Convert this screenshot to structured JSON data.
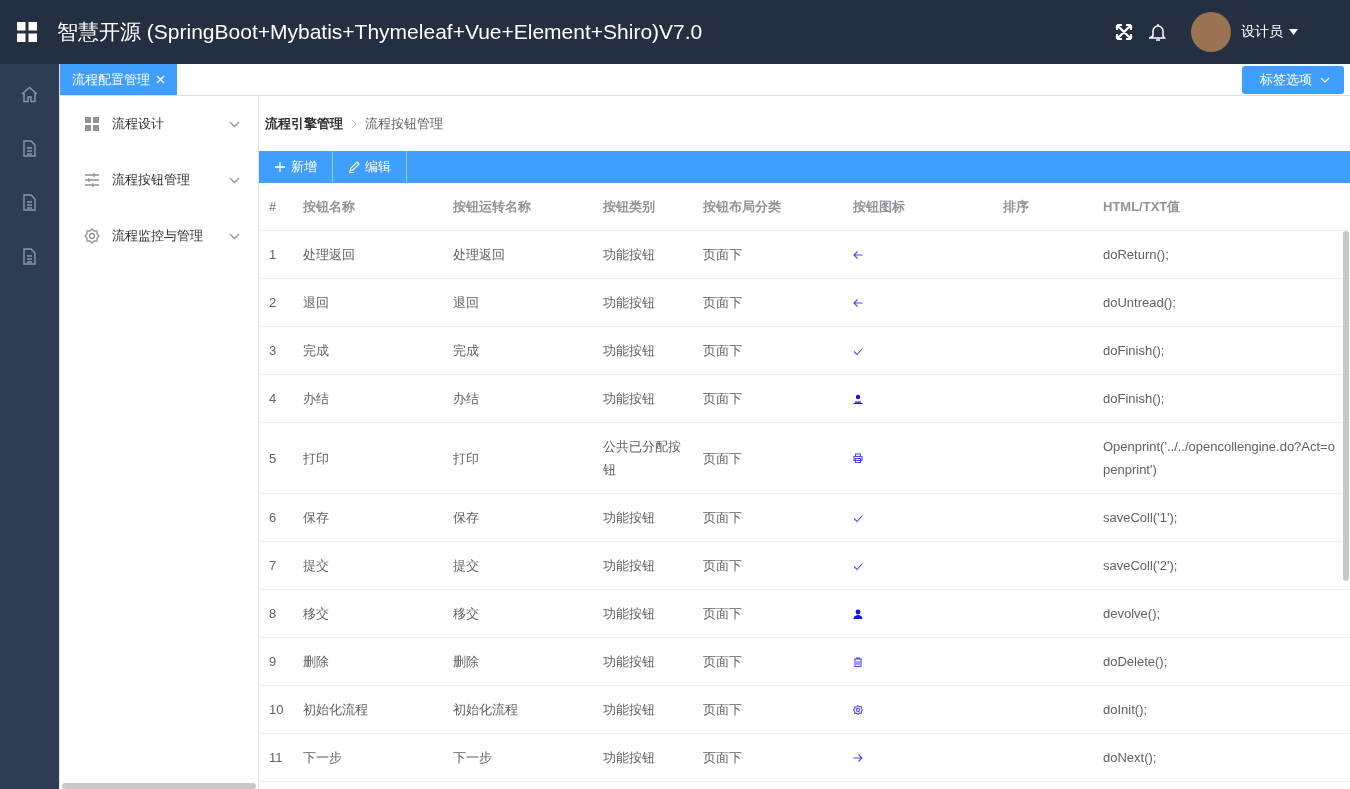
{
  "header": {
    "title": "智慧开源 (SpringBoot+Mybatis+Thymeleaf+Vue+Element+Shiro)V7.0",
    "user": "设计员"
  },
  "tabs": [
    {
      "label": "流程配置管理",
      "selected": true
    }
  ],
  "tab_options": "标签选项",
  "menu": [
    {
      "label": "流程设计",
      "kind": "grid",
      "expanded": false
    },
    {
      "label": "流程按钮管理",
      "kind": "sliders",
      "expanded": false
    },
    {
      "label": "流程监控与管理",
      "kind": "gear",
      "expanded": false
    }
  ],
  "breadcrumb": [
    "流程引擎管理",
    "流程按钮管理"
  ],
  "toolbar": [
    {
      "label": "新增",
      "kind": "add"
    },
    {
      "label": "编辑",
      "kind": "edit"
    }
  ],
  "table": {
    "columns": [
      "#",
      "按钮名称",
      "按钮运转名称",
      "按钮类别",
      "按钮布局分类",
      "按钮图标",
      "排序",
      "HTML/TXT值"
    ],
    "rows": [
      {
        "no": "1",
        "name": "处理返回",
        "run_name": "处理返回",
        "category": "功能按钮",
        "layout": "页面下",
        "kind": "arrow-left",
        "value": "doReturn();"
      },
      {
        "no": "2",
        "name": "退回",
        "run_name": "退回",
        "category": "功能按钮",
        "layout": "页面下",
        "kind": "arrow-left",
        "value": "doUntread();"
      },
      {
        "no": "3",
        "name": "完成",
        "run_name": "完成",
        "category": "功能按钮",
        "layout": "页面下",
        "kind": "check",
        "value": "doFinish();"
      },
      {
        "no": "4",
        "name": "办结",
        "run_name": "办结",
        "category": "功能按钮",
        "layout": "页面下",
        "kind": "stamp",
        "value": "doFinish();"
      },
      {
        "no": "5",
        "name": "打印",
        "run_name": "打印",
        "category": "公共已分配按钮",
        "layout": "页面下",
        "kind": "printer",
        "value": "Openprint('../../opencollengine.do?Act=openprint')"
      },
      {
        "no": "6",
        "name": "保存",
        "run_name": "保存",
        "category": "功能按钮",
        "layout": "页面下",
        "kind": "check",
        "value": "saveColl('1');"
      },
      {
        "no": "7",
        "name": "提交",
        "run_name": "提交",
        "category": "功能按钮",
        "layout": "页面下",
        "kind": "check",
        "value": "saveColl('2');"
      },
      {
        "no": "8",
        "name": "移交",
        "run_name": "移交",
        "category": "功能按钮",
        "layout": "页面下",
        "kind": "user",
        "value": "devolve();"
      },
      {
        "no": "9",
        "name": "删除",
        "run_name": "删除",
        "category": "功能按钮",
        "layout": "页面下",
        "kind": "trash",
        "value": "doDelete();"
      },
      {
        "no": "10",
        "name": "初始化流程",
        "run_name": "初始化流程",
        "category": "功能按钮",
        "layout": "页面下",
        "kind": "gear",
        "value": "doInit();"
      },
      {
        "no": "11",
        "name": "下一步",
        "run_name": "下一步",
        "category": "功能按钮",
        "layout": "页面下",
        "kind": "arrow-right",
        "value": "doNext();"
      }
    ]
  }
}
